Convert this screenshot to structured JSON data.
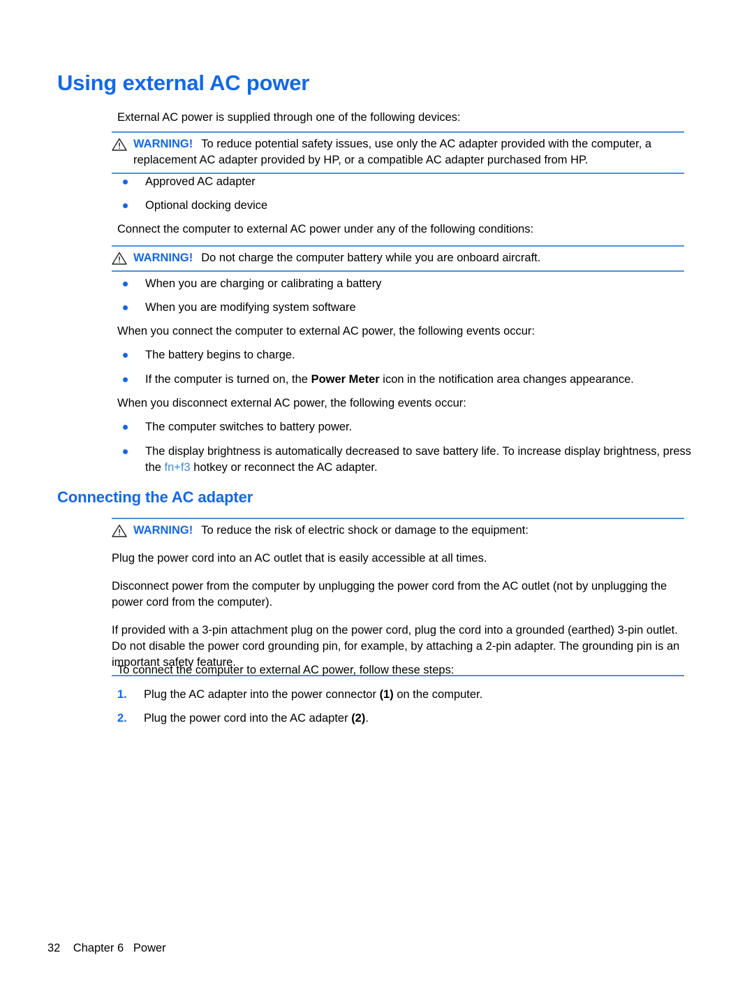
{
  "document": {
    "page_number": "32",
    "chapter": "Chapter 6",
    "chapter_topic": "Power",
    "footer_text": "32    Chapter 6   Power"
  },
  "colors": {
    "heading_blue": "#1268e8",
    "rule_blue": "#4a90e2",
    "link_blue": "#3f8ae0",
    "body_black": "#000000",
    "page_background": "#ffffff"
  },
  "headings": {
    "h1": "Using external AC power",
    "h2": "Connecting the AC adapter"
  },
  "intro": {
    "devices_lead": "External AC power is supplied through one of the following devices:",
    "conditions_lead": "Connect the computer to external AC power under any of the following conditions:",
    "connect_events_lead": "When you connect the computer to external AC power, the following events occur:",
    "disconnect_events_lead": "When you disconnect external AC power, the following events occur:",
    "steps_lead": "To connect the computer to external AC power, follow these steps:"
  },
  "warnings": {
    "label": "WARNING!",
    "icon": "warning-triangle-icon",
    "adapter": "To reduce potential safety issues, use only the AC adapter provided with the computer, a replacement AC adapter provided by HP, or a compatible AC adapter purchased from HP.",
    "aircraft": "Do not charge the computer battery while you are onboard aircraft.",
    "shock_lead": "To reduce the risk of electric shock or damage to the equipment:",
    "shock_p1": "Plug the power cord into an AC outlet that is easily accessible at all times.",
    "shock_p2": "Disconnect power from the computer by unplugging the power cord from the AC outlet (not by unplugging the power cord from the computer).",
    "shock_p3": "If provided with a 3-pin attachment plug on the power cord, plug the cord into a grounded (earthed) 3-pin outlet. Do not disable the power cord grounding pin, for example, by attaching a 2-pin adapter. The grounding pin is an important safety feature."
  },
  "device_bullets": [
    "Approved AC adapter",
    "Optional docking device"
  ],
  "condition_bullets": [
    "When you are charging or calibrating a battery",
    "When you are modifying system software"
  ],
  "connect_event_bullets": {
    "first": "The battery begins to charge.",
    "second_pre": "If the computer is turned on, the ",
    "second_bold": "Power Meter",
    "second_post": " icon in the notification area changes appearance."
  },
  "disconnect_event_bullets": {
    "first": "The computer switches to battery power.",
    "second_pre": "The display brightness is automatically decreased to save battery life. To increase display brightness, press the ",
    "second_link": "fn+f3",
    "second_post": " hotkey or reconnect the AC adapter."
  },
  "steps": {
    "step1_pre": "Plug the AC adapter into the power connector ",
    "step1_bold": "(1)",
    "step1_post": " on the computer.",
    "step1_num": "1.",
    "step2_pre": "Plug the power cord into the AC adapter ",
    "step2_bold": "(2)",
    "step2_post": ".",
    "step2_num": "2."
  }
}
